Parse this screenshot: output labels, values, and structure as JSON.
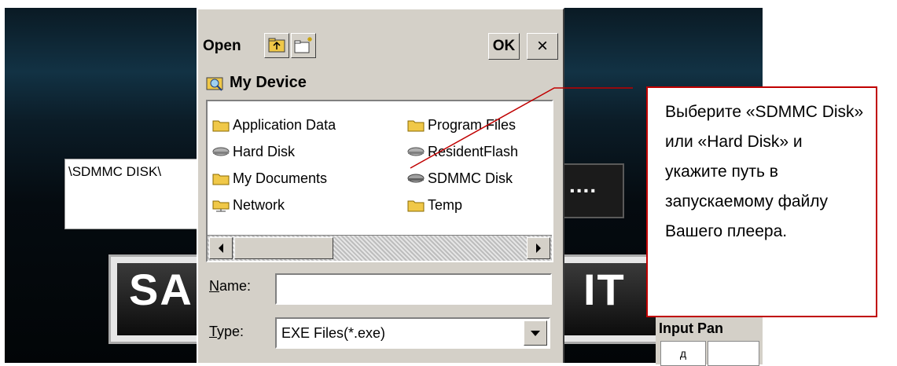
{
  "app": {
    "path_value": "\\SDMMC DISK\\",
    "browse_button": "....",
    "save_button": "SAVE",
    "exit_button": "EXIT",
    "save_visible": "SA",
    "exit_visible": "IT",
    "input_panel": "Input Panel",
    "input_panel_visible": "Input Pan",
    "input_panel_key": "д"
  },
  "dialog": {
    "title": "Open",
    "ok_label": "OK",
    "close_label": "×",
    "location": "My Device",
    "files": [
      {
        "label": "Application Data",
        "icon": "folder-icon"
      },
      {
        "label": "Program Files",
        "icon": "folder-icon"
      },
      {
        "label": "Hard Disk",
        "icon": "drive-icon"
      },
      {
        "label": "ResidentFlash",
        "icon": "drive-icon"
      },
      {
        "label": "My Documents",
        "icon": "folder-icon"
      },
      {
        "label": "SDMMC Disk",
        "icon": "drive-icon"
      },
      {
        "label": "Network",
        "icon": "network-folder-icon"
      },
      {
        "label": "Temp",
        "icon": "folder-icon"
      }
    ],
    "name_label_first": "N",
    "name_label_rest": "ame:",
    "name_value": "",
    "type_label_first": "T",
    "type_label_rest": "ype:",
    "type_value": "EXE Files(*.exe)"
  },
  "callout": {
    "text": "Выберите «SDMMC Disk» или «Hard Disk» и укажите путь в запускаемому файлу Вашего плеера."
  },
  "colors": {
    "callout_border": "#c00000",
    "dialog_bg": "#d4d0c8",
    "folder": "#f0c848"
  }
}
